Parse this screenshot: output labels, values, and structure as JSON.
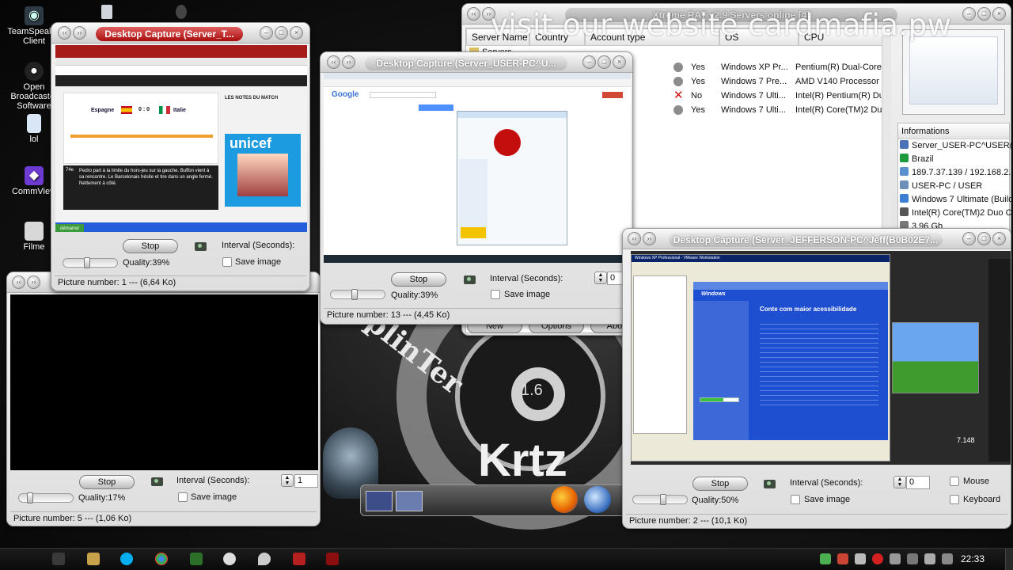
{
  "desktop_icons": [
    {
      "label": "TeamSpeak 3 Client"
    },
    {
      "label": "Open Broadcaster Software"
    },
    {
      "label": "lol"
    },
    {
      "label": "CommView"
    },
    {
      "label": "Filme"
    }
  ],
  "overlay": {
    "text": "visit our website cardmafia.pw"
  },
  "main_window": {
    "title": "Xtreme RAT v2.9 Servers online [4]",
    "columns": [
      "Server Name",
      "Country",
      "Account type",
      "OS",
      "CPU"
    ],
    "tree_item": "Servers",
    "rows": [
      {
        "admin": "Yes",
        "os": "Windows XP Pr...",
        "cpu": "Pentium(R) Dual-Core C"
      },
      {
        "admin": "Yes",
        "os": "Windows 7 Pre...",
        "cpu": "AMD V140 Processor"
      },
      {
        "admin": "No",
        "os": "Windows 7 Ulti...",
        "cpu": "Intel(R) Pentium(R) Dual"
      },
      {
        "admin": "Yes",
        "os": "Windows 7 Ulti...",
        "cpu": "Intel(R) Core(TM)2 Duo"
      }
    ],
    "info": {
      "header": "Informations",
      "items": [
        "Server_USER-PC^USER(3",
        "Brazil",
        "189.7.37.139 / 192.168.2.",
        "USER-PC / USER",
        "Windows 7 Ultimate (Build",
        "Intel(R) Core(TM)2 Duo CF",
        "3.96 Gb"
      ]
    },
    "buttons": [
      "New",
      "Options",
      "About"
    ]
  },
  "capture_windows": [
    {
      "id": "w1",
      "title": "Desktop Capture (Server_T...",
      "stop_label": "Stop",
      "quality_label": "Quality:39%",
      "quality": 0.39,
      "interval_label": "Interval (Seconds):",
      "save_image_label": "Save image",
      "status": "Picture number: 1 --- (6,64 Ko)",
      "preview": {
        "match_title": "LES NOTES DU MATCH",
        "team_left": "Espagne",
        "team_right": "Italie",
        "score": "0 : 0",
        "brand": "unicef",
        "commentary": "Pedro part à la limite du hors-jeu sur la gauche. Buffon vient à sa rencontre. Le Barcelonais hésite et tire dans un angle fermé. Nettement à côté.",
        "minute": "74e",
        "start_label": "démarrer"
      }
    },
    {
      "id": "w2",
      "title": "Desktop Capture (Server_USER-PC^U...",
      "stop_label": "Stop",
      "quality_label": "Quality:39%",
      "quality": 0.39,
      "interval_label": "Interval (Seconds):",
      "interval_value": "0",
      "save_image_label": "Save image",
      "status": "Picture number: 13 --- (4,45 Ko)",
      "preview": {
        "brand": "Google"
      }
    },
    {
      "id": "w3",
      "title": "",
      "stop_label": "Stop",
      "quality_label": "Quality:17%",
      "quality": 0.17,
      "interval_label": "Interval (Seconds):",
      "interval_value": "1",
      "save_image_label": "Save image",
      "status": "Picture number: 5 --- (1,06 Ko)"
    },
    {
      "id": "w4",
      "title": "Desktop Capture (Server_JEFFERSON-PC^Jeff(B0B02E7...",
      "stop_label": "Stop",
      "quality_label": "Quality:50%",
      "quality": 0.5,
      "interval_label": "Interval (Seconds):",
      "interval_value": "0",
      "save_image_label": "Save image",
      "mouse_label": "Mouse",
      "keyboard_label": "Keyboard",
      "status": "Picture number: 2 --- (10,1 Ko)",
      "preview": {
        "vm_title": "Windows XP Professional - VMware Workstation",
        "setup_heading": "Conte com maior acessibilidade",
        "setup_logo": "Windows",
        "counter": "7.148"
      }
    }
  ],
  "wallpaper": {
    "text_a": "plinTer",
    "text_b": "1.6",
    "text_c": "Krtz"
  },
  "taskbar": {
    "clock": "22:33"
  },
  "colors": {
    "title_active": "#c01818",
    "xp_blue": "#1f4fd1",
    "taskbar": "#111111"
  }
}
